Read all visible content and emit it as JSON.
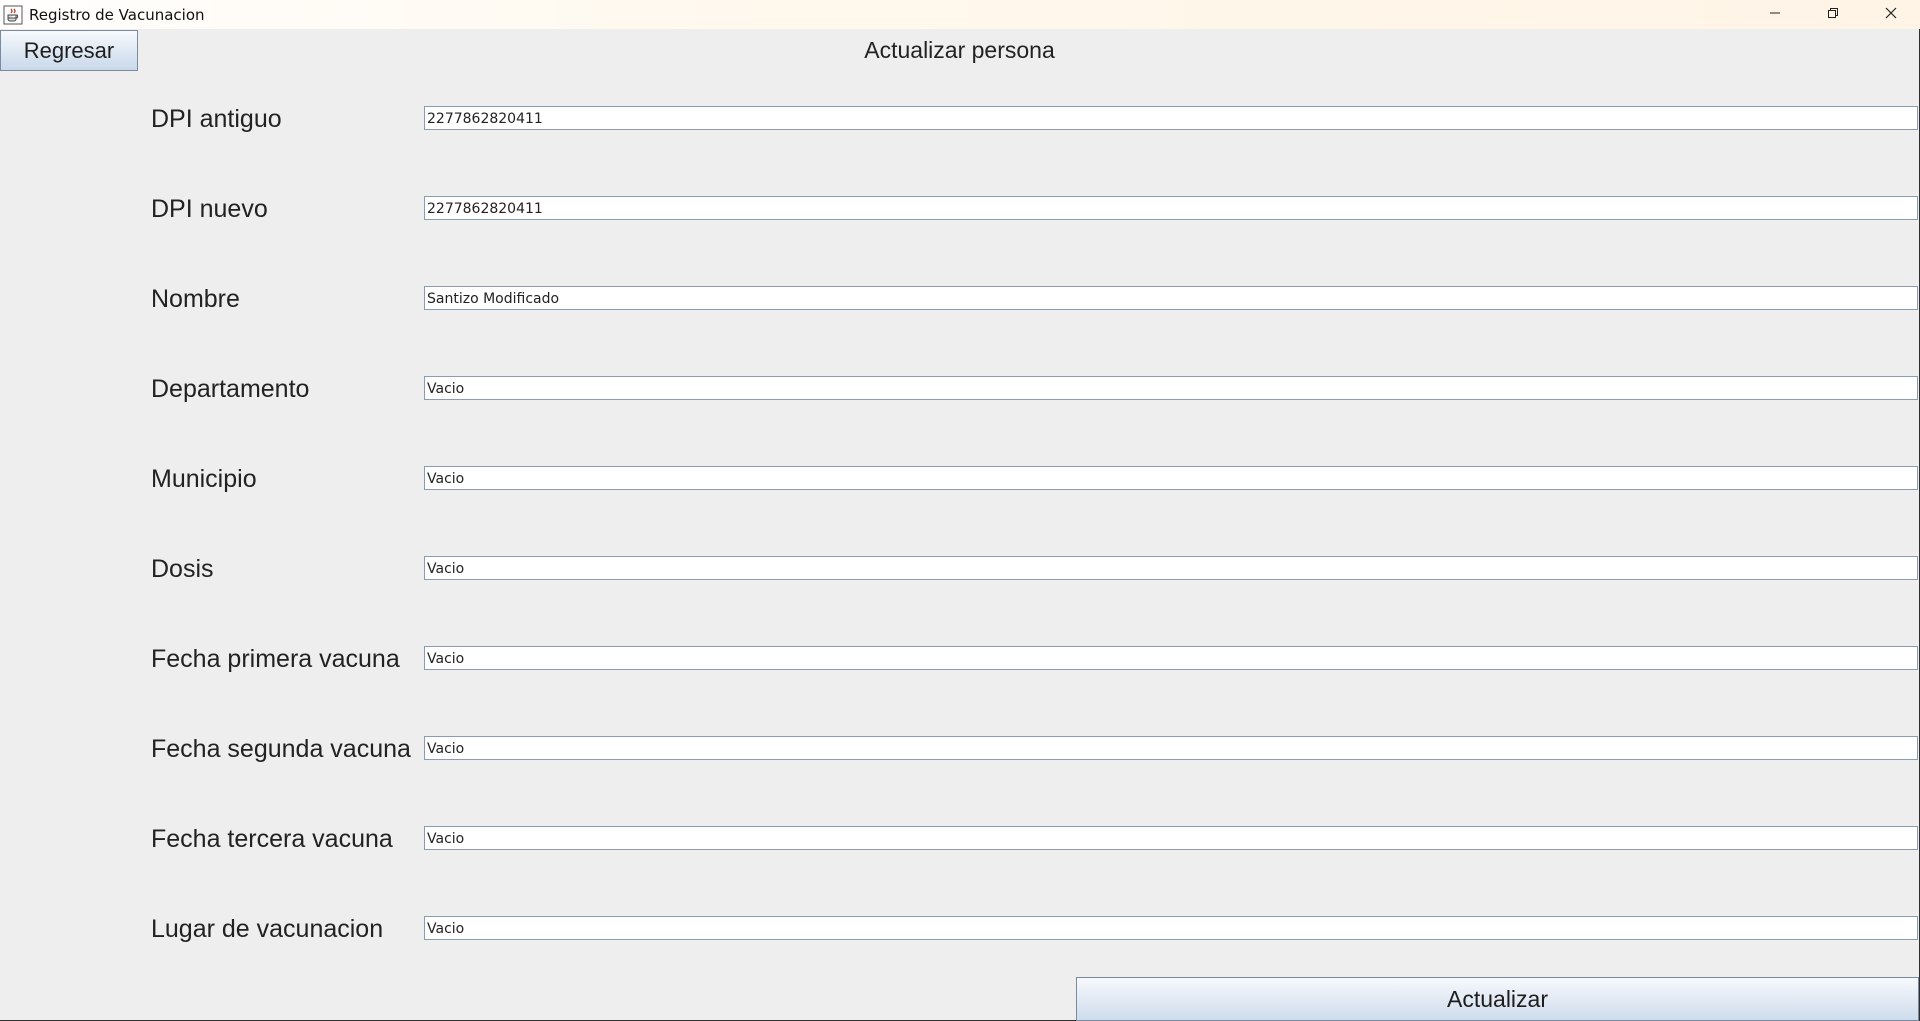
{
  "window": {
    "title": "Registro de Vacunacion",
    "app_icon": "java-cup-icon",
    "controls": {
      "minimize_icon": "minimize-icon",
      "maximize_icon": "restore-icon",
      "close_icon": "close-icon"
    }
  },
  "toolbar": {
    "back_label": "Regresar"
  },
  "page": {
    "title": "Actualizar persona"
  },
  "form": {
    "fields": [
      {
        "label": "DPI antiguo",
        "value": "2277862820411"
      },
      {
        "label": "DPI nuevo",
        "value": "2277862820411"
      },
      {
        "label": "Nombre",
        "value": "Santizo Modificado"
      },
      {
        "label": "Departamento",
        "value": "Vacio"
      },
      {
        "label": "Municipio",
        "value": "Vacio"
      },
      {
        "label": "Dosis",
        "value": "Vacio"
      },
      {
        "label": "Fecha primera vacuna",
        "value": "Vacio"
      },
      {
        "label": "Fecha segunda vacuna",
        "value": "Vacio"
      },
      {
        "label": "Fecha tercera vacuna",
        "value": "Vacio"
      },
      {
        "label": "Lugar de vacunacion",
        "value": "Vacio"
      }
    ],
    "submit_label": "Actualizar"
  },
  "colors": {
    "background": "#eeeeee",
    "field_border": "#8a9bb2",
    "button_gradient_top": "#f7f9fc",
    "button_gradient_bottom": "#c9d8ea"
  }
}
